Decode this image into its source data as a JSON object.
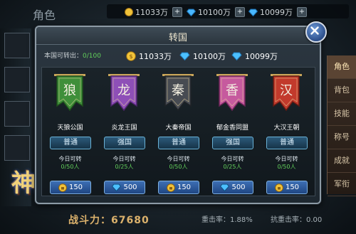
{
  "background": {
    "title": "角色",
    "currency": [
      {
        "icon": "gold-coin-icon",
        "value": "11033万"
      },
      {
        "icon": "diamond-icon",
        "value": "10100万"
      },
      {
        "icon": "diamond-icon",
        "value": "10099万"
      }
    ],
    "side_tabs": [
      "角色",
      "背包",
      "技能",
      "称号",
      "成就",
      "军衔"
    ],
    "power_label": "战斗力：",
    "power_value": "67680",
    "stats": [
      {
        "label": "重击率：",
        "value": "1.88%"
      },
      {
        "label": "抗重击率：",
        "value": "0.00"
      }
    ],
    "logo_text": "神怒"
  },
  "modal": {
    "title": "转国",
    "transfer_label": "本国可转出：",
    "transfer_value": "0/100",
    "resources": [
      {
        "icon": "gold-coin-icon",
        "value": "11033万"
      },
      {
        "icon": "diamond-icon",
        "value": "10100万"
      },
      {
        "icon": "diamond-icon",
        "value": "10099万"
      }
    ],
    "nations": [
      {
        "name": "天狼公国",
        "glyph": "狼",
        "type": "普通",
        "today_label": "今日可转",
        "quota": "0/50人",
        "cost": "150",
        "cost_icon": "lock-coin-icon",
        "flag_color": "#3f8f3a",
        "flag_dark": "#1f4f1c"
      },
      {
        "name": "炎龙王国",
        "glyph": "龙",
        "type": "强国",
        "today_label": "今日可转",
        "quota": "0/25人",
        "cost": "500",
        "cost_icon": "diamond-icon",
        "flag_color": "#8e4fb7",
        "flag_dark": "#4a2468"
      },
      {
        "name": "大秦帝国",
        "glyph": "秦",
        "type": "普通",
        "today_label": "今日可转",
        "quota": "0/50人",
        "cost": "150",
        "cost_icon": "lock-coin-icon",
        "flag_color": "#474b52",
        "flag_dark": "#1f2226"
      },
      {
        "name": "郁金香同盟",
        "glyph": "香",
        "type": "强国",
        "today_label": "今日可转",
        "quota": "0/25人",
        "cost": "500",
        "cost_icon": "diamond-icon",
        "flag_color": "#c65a9e",
        "flag_dark": "#6a2557"
      },
      {
        "name": "大汉王朝",
        "glyph": "汉",
        "type": "普通",
        "today_label": "今日可转",
        "quota": "0/50人",
        "cost": "150",
        "cost_icon": "lock-coin-icon",
        "flag_color": "#c23a2c",
        "flag_dark": "#621a12"
      }
    ]
  }
}
